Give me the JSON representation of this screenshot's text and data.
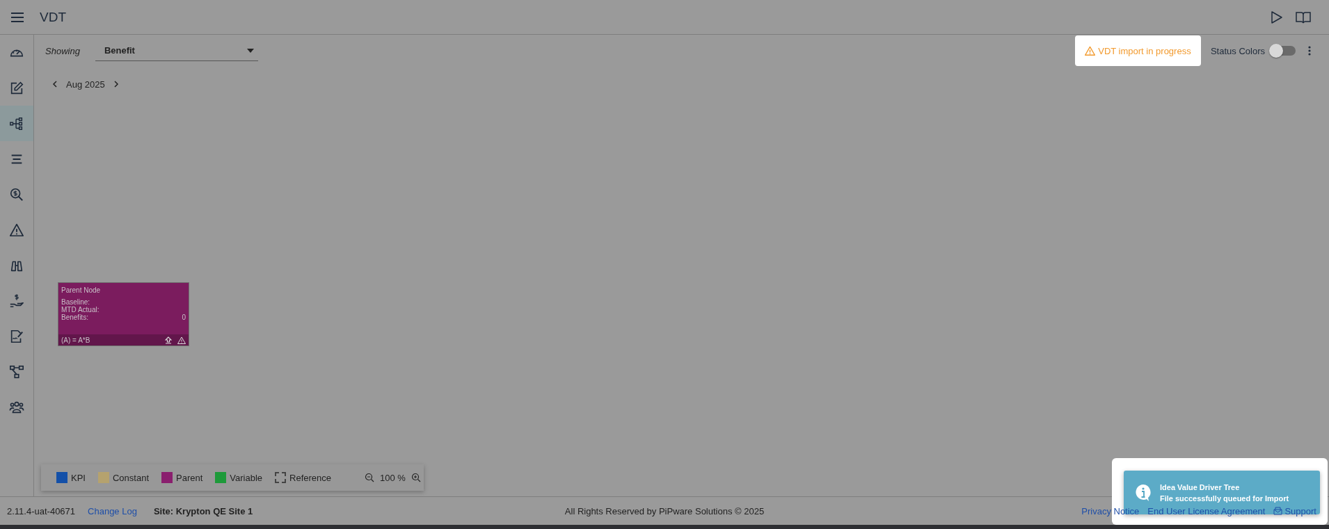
{
  "header": {
    "title": "VDT"
  },
  "sidebar": {
    "items": [
      {
        "kind": "gauge",
        "selected": false
      },
      {
        "kind": "edit",
        "selected": false
      },
      {
        "kind": "tree",
        "selected": true
      },
      {
        "kind": "list",
        "selected": false
      },
      {
        "kind": "money-search",
        "selected": false
      },
      {
        "kind": "warning",
        "selected": false
      },
      {
        "kind": "binoculars",
        "selected": false
      },
      {
        "kind": "hand-money",
        "selected": false
      },
      {
        "kind": "signature",
        "selected": false
      },
      {
        "kind": "flow",
        "selected": false
      },
      {
        "kind": "people",
        "selected": false
      }
    ]
  },
  "toolbar": {
    "showing_label": "Showing",
    "dropdown": {
      "value": "Benefit"
    },
    "alert": "VDT import in progress",
    "status_colors": {
      "label": "Status Colors",
      "on": false
    }
  },
  "date_nav": {
    "period": "Aug 2025"
  },
  "node": {
    "title": "Parent Node",
    "color": "#7b1c5e",
    "rows": [
      {
        "label": "Baseline:"
      },
      {
        "label": "MTD Actual:"
      },
      {
        "label": "Benefits:",
        "value": "0"
      }
    ],
    "formula": "(A) = A*B"
  },
  "legend": {
    "items": [
      {
        "label": "KPI",
        "kind": "solid",
        "color": "#1450a8"
      },
      {
        "label": "Constant",
        "kind": "solid",
        "color": "#b5a26e"
      },
      {
        "label": "Parent",
        "kind": "solid",
        "color": "#8a1f6e"
      },
      {
        "label": "Variable",
        "kind": "solid",
        "color": "#1e9a3a"
      },
      {
        "label": "Reference",
        "kind": "dashed"
      }
    ],
    "zoom": "100 %"
  },
  "footer": {
    "version": "2.11.4-uat-40671",
    "change_log": "Change Log",
    "site": "Site: Krypton QE Site 1",
    "copyright": "All Rights Reserved by PiPware Solutions © 2025",
    "links": [
      {
        "label": "Privacy Notice",
        "kind": "text"
      },
      {
        "label": "End User License Agreement",
        "kind": "text"
      },
      {
        "label": "Support",
        "kind": "mail"
      }
    ]
  },
  "toast": {
    "title": "Idea Value Driver Tree",
    "message": "File successfully queued for Import"
  }
}
